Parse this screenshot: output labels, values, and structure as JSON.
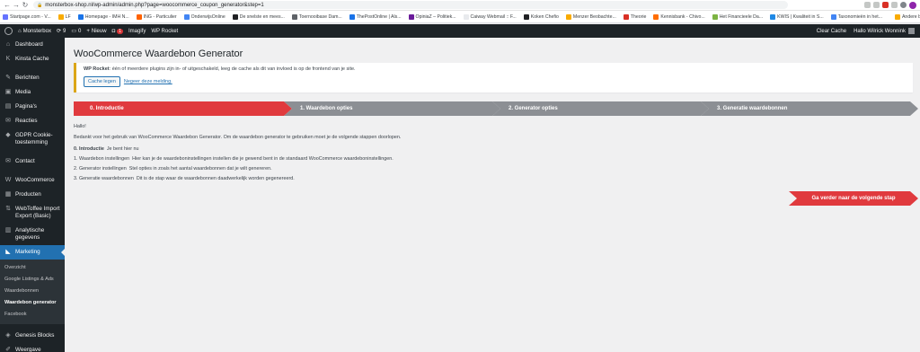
{
  "browser": {
    "url": "monsterbox-shop.nl/wp-admin/admin.php?page=woocommerce_coupon_generator&step=1",
    "bookmarks": [
      {
        "label": "Startpage.com - V...",
        "color": "#6573ff"
      },
      {
        "label": "LF",
        "color": "#f9ab00"
      },
      {
        "label": "Homepage - IMH N...",
        "color": "#1a73e8"
      },
      {
        "label": "ING - Particulier",
        "color": "#ff6200"
      },
      {
        "label": "OnderwijsOnline",
        "color": "#4285f4"
      },
      {
        "label": "De snelste en mees...",
        "color": "#202124"
      },
      {
        "label": "Toernooibase Dam...",
        "color": "#5f6368"
      },
      {
        "label": "ThePostOnline | Als...",
        "color": "#1a73e8"
      },
      {
        "label": "OpiniaZ – Politiek...",
        "color": "#6a1b9a"
      },
      {
        "label": "Caiway Webmail :: F...",
        "color": "#e8eaed"
      },
      {
        "label": "Koken Chefio",
        "color": "#202124"
      },
      {
        "label": "Menzer Beobachte...",
        "color": "#f9ab00"
      },
      {
        "label": "Theorie",
        "color": "#d93025"
      },
      {
        "label": "Kennisbank - Chivo...",
        "color": "#ff6d00"
      },
      {
        "label": "Het Financieele Da...",
        "color": "#7cb342"
      },
      {
        "label": "KWIS | Kwaliteit in S...",
        "color": "#1e88e5"
      },
      {
        "label": "Taxonomieën in het...",
        "color": "#4285f4"
      },
      {
        "label": "Andere bookmarks",
        "color": "#f9ab00"
      }
    ]
  },
  "adminbar": {
    "site": "Monsterbox",
    "updates": "9",
    "comments": "0",
    "new": "Nieuw",
    "notif_count": "1",
    "imagify": "Imagify",
    "wprocket": "WP Rocket",
    "clear_cache": "Clear Cache",
    "greeting": "Hallo Wilrick Wonnink"
  },
  "sidebar": {
    "items": [
      {
        "label": "Dashboard",
        "icon": "⌂"
      },
      {
        "label": "Kinsta Cache",
        "icon": "K"
      },
      {
        "label": "Berichten",
        "icon": "✎"
      },
      {
        "label": "Media",
        "icon": "▣"
      },
      {
        "label": "Pagina's",
        "icon": "▤"
      },
      {
        "label": "Reacties",
        "icon": "✉"
      },
      {
        "label": "GDPR Cookie-toestemming",
        "icon": "◆"
      },
      {
        "label": "Contact",
        "icon": "✉"
      },
      {
        "label": "WooCommerce",
        "icon": "W"
      },
      {
        "label": "Producten",
        "icon": "▦"
      },
      {
        "label": "WebToffee Import Export (Basic)",
        "icon": "⇅"
      },
      {
        "label": "Analytische gegevens",
        "icon": "▥"
      },
      {
        "label": "Marketing",
        "icon": "◣"
      }
    ],
    "submenu": [
      "Overzicht",
      "Google Listings & Ads",
      "Waardebonnen",
      "Waardebon generator",
      "Facebook"
    ],
    "bottom": [
      {
        "label": "Genesis Blocks",
        "icon": "◈"
      },
      {
        "label": "Weergave",
        "icon": "✐"
      }
    ]
  },
  "main": {
    "title": "WooCommerce Waardebon Generator",
    "notice": {
      "strong": "WP Rocket",
      "text": ": één of meerdere plugins zijn in- of uitgeschakeld, leeg de cache als dit van invloed is op de frontend van je site.",
      "button": "Cache legen",
      "dismiss": "Negeer deze melding."
    },
    "steps": [
      "0. Introductie",
      "1. Waardebon opties",
      "2. Generator opties",
      "3. Generatie waardebonnen"
    ],
    "greeting": "Hallo!",
    "intro": "Bedankt voor het gebruik van WooCommerce Waardebon Generator. Om de waardebon generator te gebruiken moet je de volgende stappen doorlopen.",
    "step_lines": [
      {
        "title": "0. Introductie",
        "desc": "Je bent hier nu"
      },
      {
        "title": "1. Waardebon instellingen",
        "desc": "Hier kan je de waardeboninstellingen instellen die je gewend bent in de standaard WooCommerce waardeboninstellingen."
      },
      {
        "title": "2. Generator instellingen",
        "desc": "Stel opties in zoals het aantal waardebonnen dat je wilt genereren."
      },
      {
        "title": "3. Generatie waardebonnen",
        "desc": "Dit is de stap waar de waardebonnen daadwerkelijk worden gegenereerd."
      }
    ],
    "next_button": "Ga verder naar de volgende stap"
  },
  "colors": {
    "accent": "#e03a3e",
    "inactive_step": "#8c8f94",
    "admin_dark": "#1d2327",
    "admin_blue": "#2271b1"
  }
}
